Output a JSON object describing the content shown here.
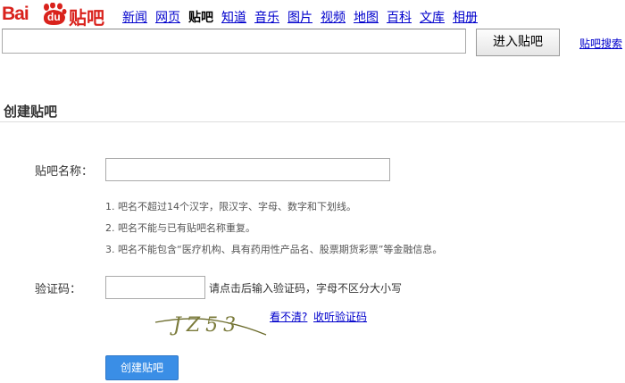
{
  "logo": {
    "part1": "Bai",
    "part2": "du",
    "part3": "贴吧",
    "paw_color": "#d9221c"
  },
  "nav": {
    "items": [
      {
        "label": "新闻"
      },
      {
        "label": "网页"
      },
      {
        "label": "贴吧",
        "active": true
      },
      {
        "label": "知道"
      },
      {
        "label": "音乐"
      },
      {
        "label": "图片"
      },
      {
        "label": "视频"
      },
      {
        "label": "地图"
      },
      {
        "label": "百科"
      },
      {
        "label": "文库"
      },
      {
        "label": "相册"
      }
    ]
  },
  "search": {
    "value": "",
    "button": "进入贴吧",
    "link": "贴吧搜索"
  },
  "page": {
    "title": "创建贴吧"
  },
  "form": {
    "name_label": "贴吧名称：",
    "name_value": "",
    "rules": [
      "1. 吧名不超过14个汉字，限汉字、字母、数字和下划线。",
      "2. 吧名不能与已有贴吧名称重复。",
      "3. 吧名不能包含“医疗机构、具有药用性产品名、股票期货彩票”等金融信息。"
    ],
    "code_label": "验证码：",
    "code_value": "",
    "code_hint": "请点击后输入验证码，字母不区分大小写",
    "captcha_text": "JZ53",
    "refresh_link": "看不清?",
    "audio_link": "收听验证码",
    "submit": "创建贴吧"
  },
  "colors": {
    "brand_red": "#d9221c",
    "link_blue": "#0000cc",
    "button_blue": "#3a8ee6"
  }
}
